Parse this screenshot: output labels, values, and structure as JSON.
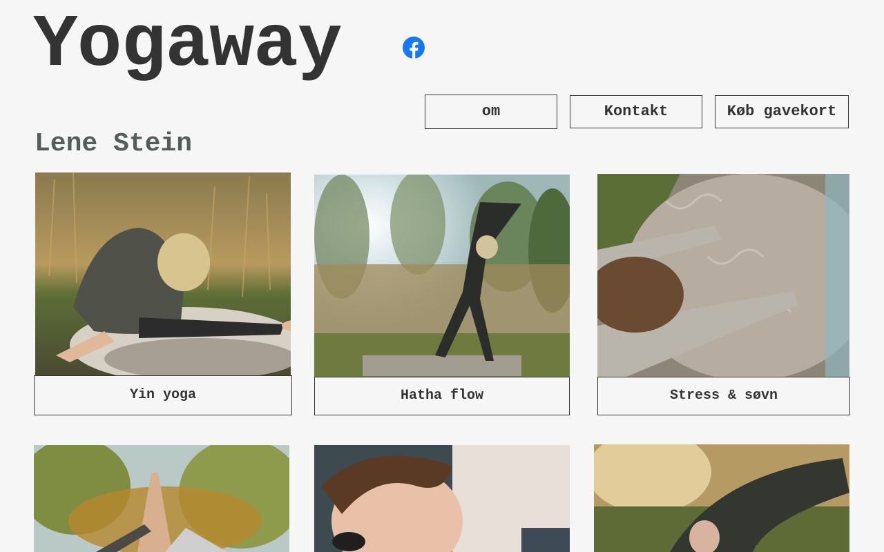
{
  "site": {
    "title": "Yogaway",
    "subtitle": "Lene Stein"
  },
  "social": {
    "icon": "facebook-icon",
    "color": "#1877f2"
  },
  "nav": {
    "items": [
      {
        "label": "om"
      },
      {
        "label": "Kontakt"
      },
      {
        "label": "Køb gavekort"
      }
    ]
  },
  "classes": [
    {
      "label": "Yin yoga"
    },
    {
      "label": "Hatha flow"
    },
    {
      "label": "Stress & søvn"
    }
  ],
  "colors": {
    "background": "#f6f6f6",
    "text": "#333333",
    "subtitle": "#555d59"
  }
}
